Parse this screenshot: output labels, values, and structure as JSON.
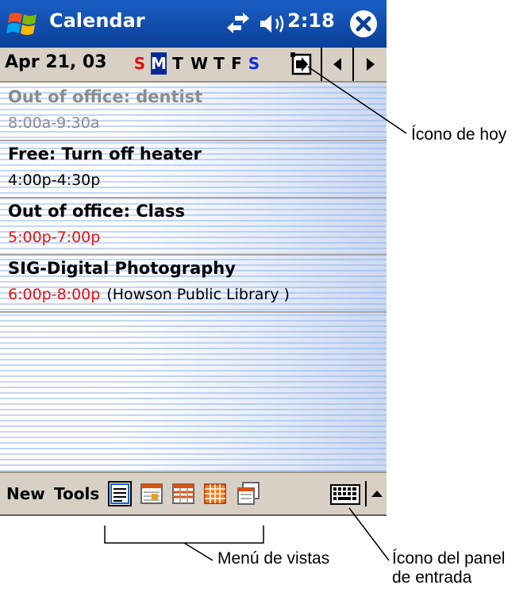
{
  "title_bar": {
    "title": "Calendar",
    "time": "2:18"
  },
  "date_bar": {
    "date": "Apr 21, 03",
    "days": [
      {
        "letter": "S",
        "style": "red"
      },
      {
        "letter": "M",
        "style": "selected"
      },
      {
        "letter": "T",
        "style": "normal"
      },
      {
        "letter": "W",
        "style": "normal"
      },
      {
        "letter": "T",
        "style": "normal"
      },
      {
        "letter": "F",
        "style": "normal"
      },
      {
        "letter": "S",
        "style": "blue"
      }
    ]
  },
  "appointments": [
    {
      "title": "Out of office: dentist",
      "time": "8:00a-9:30a",
      "location": "",
      "dim": true,
      "time_red": false
    },
    {
      "title": "Free: Turn off heater",
      "time": "4:00p-4:30p",
      "location": "",
      "dim": false,
      "time_red": false
    },
    {
      "title": "Out of office: Class",
      "time": "5:00p-7:00p",
      "location": "",
      "dim": false,
      "time_red": true
    },
    {
      "title": "SIG-Digital Photography",
      "time": "6:00p-8:00p",
      "location": "(Howson Public Library )",
      "dim": false,
      "time_red": true
    }
  ],
  "command_bar": {
    "new_label": "New",
    "tools_label": "Tools"
  },
  "callouts": {
    "today_icon": "Ícono de hoy",
    "views_menu": "Menú de vistas",
    "input_panel_line1": "Ícono del panel",
    "input_panel_line2": "de entrada"
  },
  "colors": {
    "title_bar": "#0b3f98",
    "red": "#ee1111",
    "blue": "#1030e0",
    "toolbar": "#d8d0c4"
  }
}
